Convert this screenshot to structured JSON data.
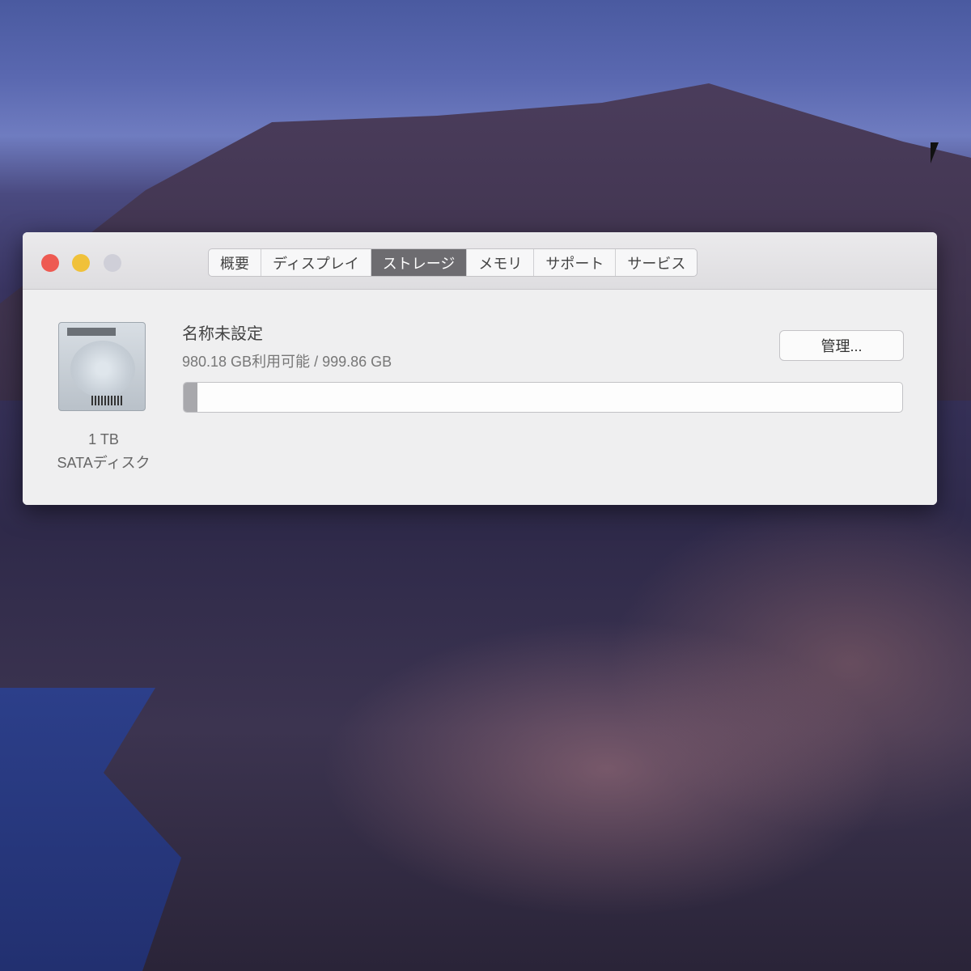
{
  "window": {
    "traffic_lights": {
      "close": "#ee5a52",
      "minimize": "#f0c13a",
      "zoom": "#cfcfd8"
    },
    "tabs": [
      {
        "label": "概要"
      },
      {
        "label": "ディスプレイ"
      },
      {
        "label": "ストレージ",
        "active": true
      },
      {
        "label": "メモリ"
      },
      {
        "label": "サポート"
      },
      {
        "label": "サービス"
      }
    ]
  },
  "storage": {
    "disk_size": "1 TB",
    "disk_type": "SATAディスク",
    "volume_name": "名称未設定",
    "capacity_text": "980.18 GB利用可能 / 999.86 GB",
    "used_fraction": 0.0197,
    "manage_button": "管理..."
  }
}
